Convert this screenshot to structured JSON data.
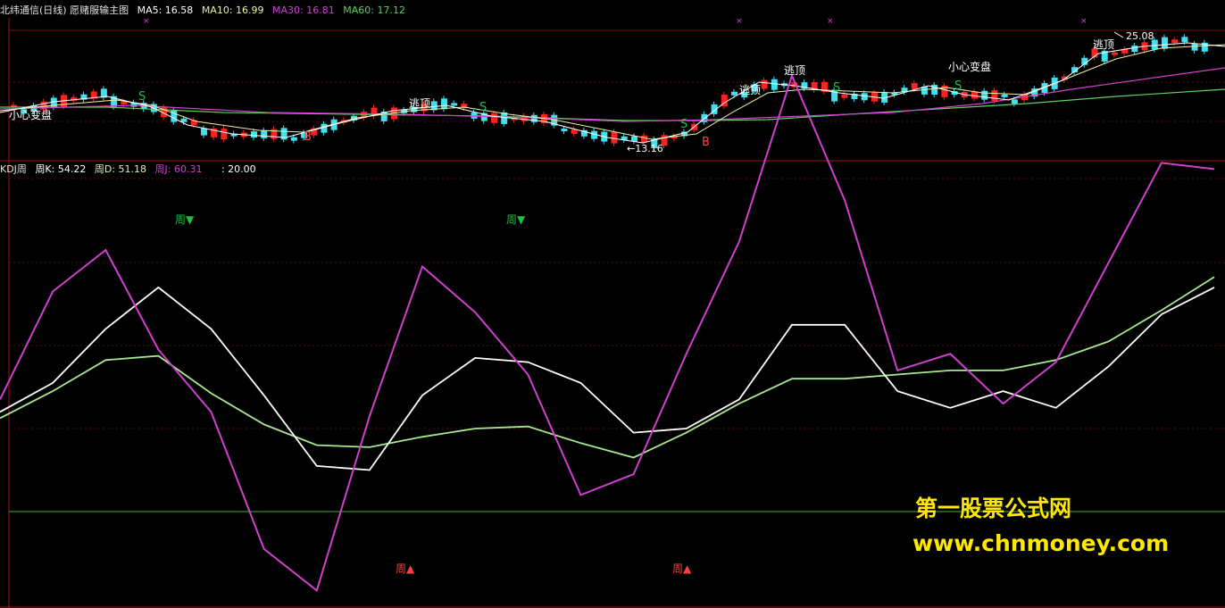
{
  "colors": {
    "background": "#000000",
    "up_candle": "#ff2020",
    "down_candle": "#40e0f0",
    "ma5": "#ffffff",
    "ma10": "#f0f0a0",
    "ma30": "#d040d0",
    "ma60": "#60d060",
    "k_line": "#ffffff",
    "d_line": "#a8e890",
    "j_line": "#d040d0",
    "grid": "#7a1010",
    "signal_buy": "#ff4040",
    "signal_sell": "#20c040",
    "watermark": "#ffe800"
  },
  "price_panel": {
    "title": "北纬通信(日线) 愿赌服输主图",
    "ma5": "MA5: 16.58",
    "ma10": "MA10: 16.99",
    "ma30": "MA30: 16.81",
    "ma60": "MA60: 17.12",
    "high_label": "25.08",
    "low_label": "←13.16",
    "annotations": {
      "caution_left": "小心变盘",
      "escape_top_1": "逃顶",
      "escape_top_2": "逃顶",
      "escape_top_3": "逃顶",
      "caution_right": "小心变盘",
      "escape_top_4": "逃顶"
    },
    "sell_marker": "S",
    "buy_marker": "B"
  },
  "kdj_panel": {
    "title": "KDJ周",
    "k": "周K: 54.22",
    "d": "周D: 51.18",
    "j": "周J: 60.31",
    "ref": ": 20.00",
    "week_sell_label": "周▼",
    "week_buy_label": "周▲"
  },
  "watermark": {
    "line1": "第一股票公式网",
    "line2": "www.chnmoney.com"
  },
  "chart_data": [
    {
      "type": "line",
      "title": "北纬通信(日线) 愿赌服输主图",
      "description_series": "daily candlesticks with moving averages",
      "series": [
        {
          "name": "MA5",
          "values": []
        },
        {
          "name": "MA10",
          "values": []
        },
        {
          "name": "MA30",
          "values": []
        },
        {
          "name": "MA60",
          "values": []
        }
      ],
      "labels": {
        "high": 25.08,
        "low": 13.16
      }
    },
    {
      "type": "line",
      "title": "KDJ周",
      "x": [
        0,
        1,
        2,
        3,
        4,
        5,
        6,
        7,
        8,
        9,
        10,
        11,
        12,
        13,
        14,
        15,
        16,
        17,
        18,
        19,
        20,
        21,
        22,
        23
      ],
      "series": [
        {
          "name": "周K",
          "values": [
            68,
            82,
            108,
            128,
            108,
            76,
            42,
            40,
            76,
            94,
            92,
            82,
            58,
            60,
            74,
            110,
            110,
            78,
            70,
            78,
            70,
            90,
            115,
            128
          ]
        },
        {
          "name": "周D",
          "values": [
            65,
            78,
            93,
            95,
            77,
            62,
            52,
            51,
            56,
            60,
            61,
            53,
            46,
            58,
            72,
            84,
            84,
            86,
            88,
            88,
            93,
            102,
            117,
            133
          ]
        },
        {
          "name": "周J",
          "values": [
            74,
            126,
            146,
            98,
            68,
            2,
            -18,
            66,
            138,
            116,
            86,
            28,
            38,
            96,
            150,
            230,
            170,
            88,
            96,
            72,
            92,
            140,
            188,
            185
          ]
        }
      ],
      "reference": 20.0,
      "annotations": [
        "周▼",
        "周▼",
        "周▲",
        "周▲"
      ]
    }
  ]
}
